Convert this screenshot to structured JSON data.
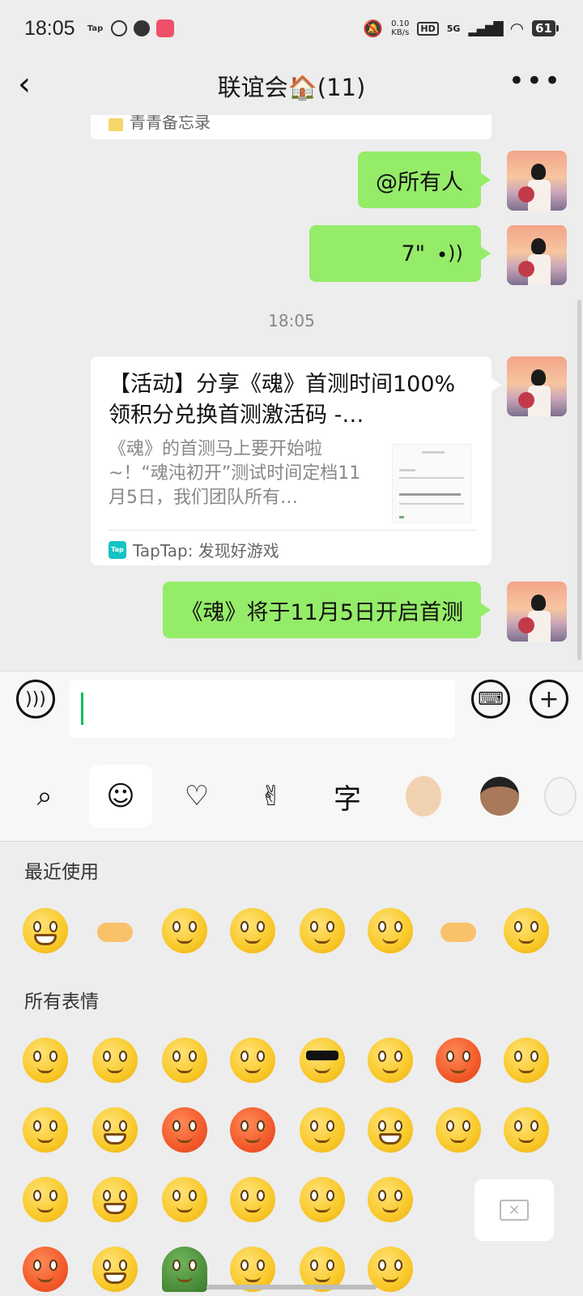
{
  "status_bar": {
    "time": "18:05",
    "left_icons": [
      "taptap-icon",
      "speedometer-icon",
      "cat-app-icon",
      "red-app-icon"
    ],
    "net_speed_value": "0.10",
    "net_speed_unit": "KB/s",
    "hd_label": "HD",
    "network_label": "5G",
    "battery": "61"
  },
  "nav": {
    "back_icon": "back-chevron-icon",
    "title": "联谊会🏠(11)",
    "more": "•••"
  },
  "chat": {
    "partial_card_text": "青青备忘录",
    "messages": [
      {
        "type": "text",
        "text": "@所有人"
      },
      {
        "type": "voice",
        "duration": "7\""
      }
    ],
    "time_label": "18:05",
    "link_card": {
      "title": "【活动】分享《魂》首测时间100%领积分兑换首测激活码 -…",
      "description": "《魂》的首测马上要开始啦~！“魂沌初开”测试时间定档11月5日，我们团队所有…",
      "source": "TapTap: 发现好游戏",
      "source_logo": "Tap"
    },
    "last_message": "《魂》将于11月5日开启首测"
  },
  "input_bar": {
    "voice_icon": "voice-input-icon",
    "keyboard_icon": "keyboard-icon",
    "plus_icon": "plus-icon"
  },
  "emoji_tabs": [
    {
      "name": "search-icon",
      "glyph": "⌕"
    },
    {
      "name": "smiley-icon",
      "glyph": "☺"
    },
    {
      "name": "heart-icon",
      "glyph": "♡"
    },
    {
      "name": "gesture-icon",
      "glyph": "✌"
    },
    {
      "name": "text-sticker-icon",
      "glyph": "字"
    },
    {
      "name": "baby-sticker-icon",
      "glyph": ""
    },
    {
      "name": "boy-sticker-icon",
      "glyph": ""
    },
    {
      "name": "rabbit-sticker-icon",
      "glyph": ""
    }
  ],
  "panel": {
    "recent_title": "最近使用",
    "all_title": "所有表情"
  }
}
